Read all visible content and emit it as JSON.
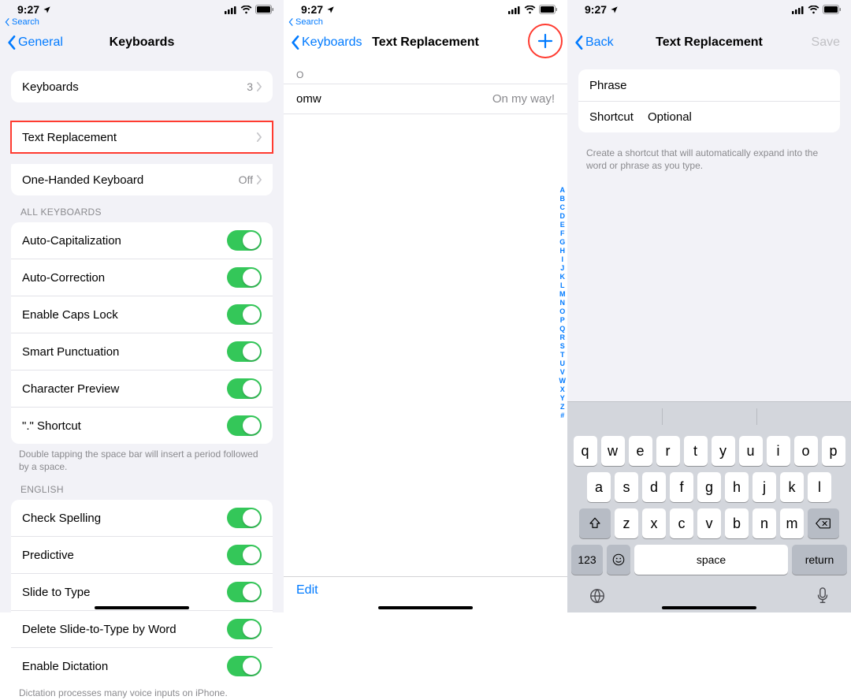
{
  "status": {
    "time": "9:27",
    "loc_arrow": true
  },
  "search_crumb": "Search",
  "phone1": {
    "back": "General",
    "title": "Keyboards",
    "g1": [
      {
        "label": "Keyboards",
        "detail": "3"
      }
    ],
    "g2": [
      {
        "label": "Text Replacement",
        "detail": "",
        "hl": true
      },
      {
        "label": "One-Handed Keyboard",
        "detail": "Off"
      }
    ],
    "all_kb_label": "ALL KEYBOARDS",
    "toggles1": [
      "Auto-Capitalization",
      "Auto-Correction",
      "Enable Caps Lock",
      "Smart Punctuation",
      "Character Preview",
      "\".\" Shortcut"
    ],
    "footnote1": "Double tapping the space bar will insert a period followed by a space.",
    "english_label": "ENGLISH",
    "toggles2": [
      "Check Spelling",
      "Predictive",
      "Slide to Type",
      "Delete Slide-to-Type by Word",
      "Enable Dictation"
    ],
    "footnote2": "Dictation processes many voice inputs on iPhone."
  },
  "phone2": {
    "back": "Keyboards",
    "title": "Text Replacement",
    "section": "O",
    "entry": {
      "phrase": "omw",
      "expansion": "On my way!"
    },
    "index": [
      "A",
      "B",
      "C",
      "D",
      "E",
      "F",
      "G",
      "H",
      "I",
      "J",
      "K",
      "L",
      "M",
      "N",
      "O",
      "P",
      "Q",
      "R",
      "S",
      "T",
      "U",
      "V",
      "W",
      "X",
      "Y",
      "Z",
      "#"
    ],
    "edit": "Edit"
  },
  "phone3": {
    "back": "Back",
    "title": "Text Replacement",
    "save": "Save",
    "phrase_label": "Phrase",
    "shortcut_label": "Shortcut",
    "shortcut_placeholder": "Optional",
    "help": "Create a shortcut that will automatically expand into the word or phrase as you type.",
    "kb": {
      "r1": [
        "q",
        "w",
        "e",
        "r",
        "t",
        "y",
        "u",
        "i",
        "o",
        "p"
      ],
      "r2": [
        "a",
        "s",
        "d",
        "f",
        "g",
        "h",
        "j",
        "k",
        "l"
      ],
      "r3": [
        "z",
        "x",
        "c",
        "v",
        "b",
        "n",
        "m"
      ],
      "num": "123",
      "space": "space",
      "return": "return"
    }
  }
}
